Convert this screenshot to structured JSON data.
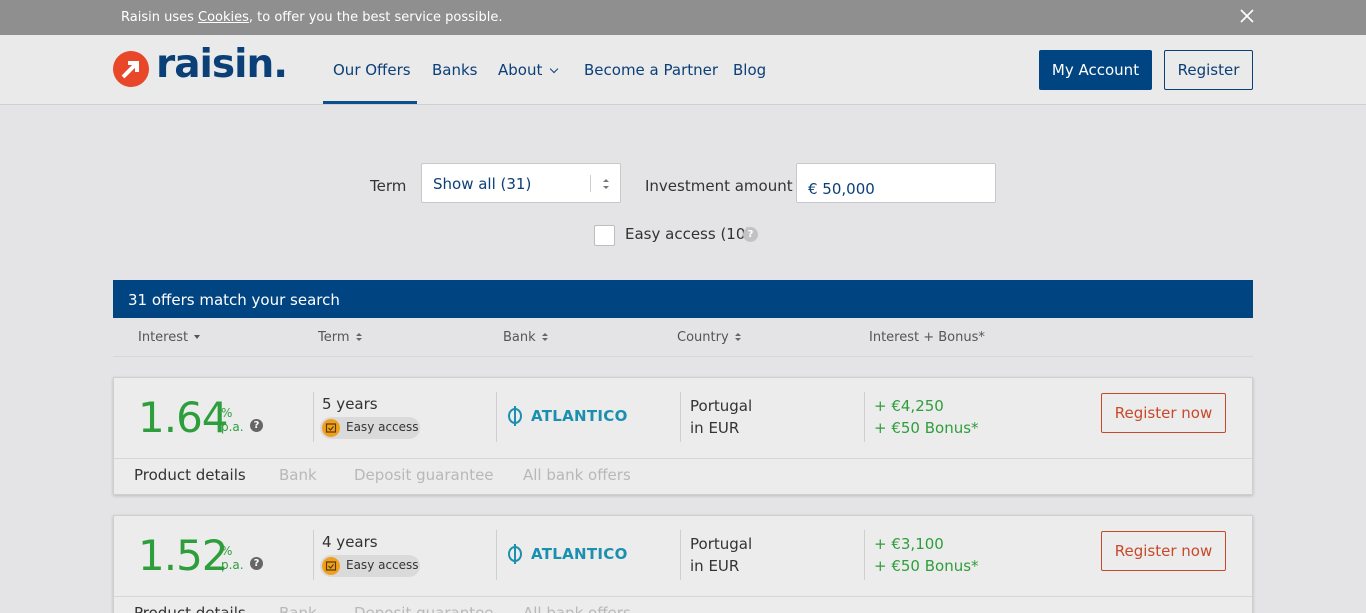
{
  "cookie_bar": {
    "text_before": "Raisin uses ",
    "link": "Cookies",
    "text_after": ", to offer you the best service possible."
  },
  "header": {
    "logo_text": "raisin.",
    "nav": [
      "Our Offers",
      "Banks",
      "About",
      "Become a Partner",
      "Blog"
    ],
    "active_nav": "Our Offers",
    "my_account": "My Account",
    "register": "Register"
  },
  "filters": {
    "term_label": "Term",
    "term_value": "Show all (31)",
    "amount_label": "Investment amount",
    "amount_value": "€ 50,000",
    "easy_access_label": "Easy access (10)"
  },
  "results": {
    "count_text": "31 offers match your search",
    "columns": [
      "Interest",
      "Term",
      "Bank",
      "Country",
      "Interest + Bonus*"
    ]
  },
  "offers": [
    {
      "rate": "1.64",
      "rate_unit_1": "%",
      "rate_unit_2": "p.a.",
      "term": "5 years",
      "badge": "Easy access",
      "bank": "ATLANTICO",
      "country": "Portugal",
      "currency": "in EUR",
      "interest": "+ €4,250",
      "bonus": "+ €50 Bonus*",
      "cta": "Register now",
      "tabs": [
        "Product details",
        "Bank",
        "Deposit guarantee",
        "All bank offers"
      ]
    },
    {
      "rate": "1.52",
      "rate_unit_1": "%",
      "rate_unit_2": "p.a.",
      "term": "4 years",
      "badge": "Easy access",
      "bank": "ATLANTICO",
      "country": "Portugal",
      "currency": "in EUR",
      "interest": "+ €3,100",
      "bonus": "+ €50 Bonus*",
      "cta": "Register now",
      "tabs": [
        "Product details",
        "Bank",
        "Deposit guarantee",
        "All bank offers"
      ]
    }
  ],
  "colors": {
    "brand_blue": "#004481",
    "accent_orange": "#e8472a",
    "rate_green": "#2e9e3c"
  }
}
